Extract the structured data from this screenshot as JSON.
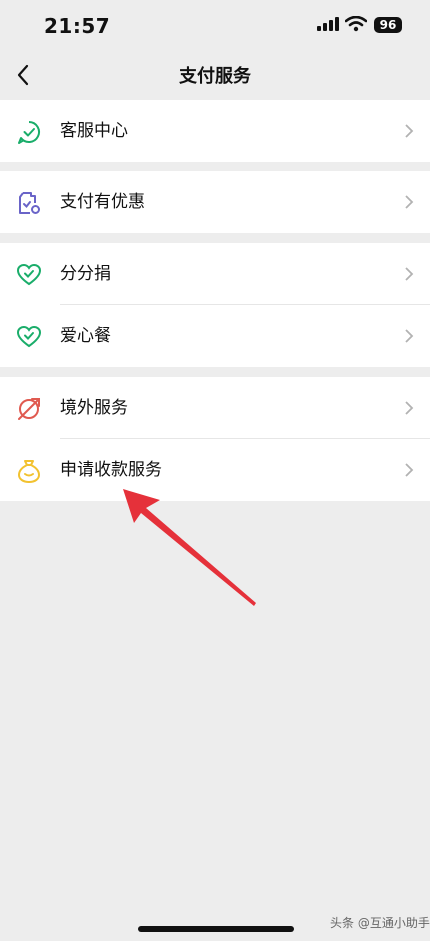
{
  "status": {
    "time": "21:57",
    "battery": "96"
  },
  "nav": {
    "title": "支付服务"
  },
  "groups": [
    {
      "items": [
        {
          "label": "客服中心",
          "icon": "customer-service-icon",
          "color": "#1aad6a"
        }
      ]
    },
    {
      "items": [
        {
          "label": "支付有优惠",
          "icon": "payment-discount-icon",
          "color": "#6a64c8"
        }
      ]
    },
    {
      "items": [
        {
          "label": "分分捐",
          "icon": "heart-check-icon",
          "color": "#1aad6a"
        },
        {
          "label": "爱心餐",
          "icon": "heart-check-icon",
          "color": "#1aad6a"
        }
      ]
    },
    {
      "items": [
        {
          "label": "境外服务",
          "icon": "globe-plane-icon",
          "color": "#e05a50"
        },
        {
          "label": "申请收款服务",
          "icon": "money-bag-icon",
          "color": "#f2c230"
        }
      ]
    }
  ],
  "annotation": {
    "arrow_color": "#e5313a"
  },
  "watermark": "头条 @互通小助手"
}
